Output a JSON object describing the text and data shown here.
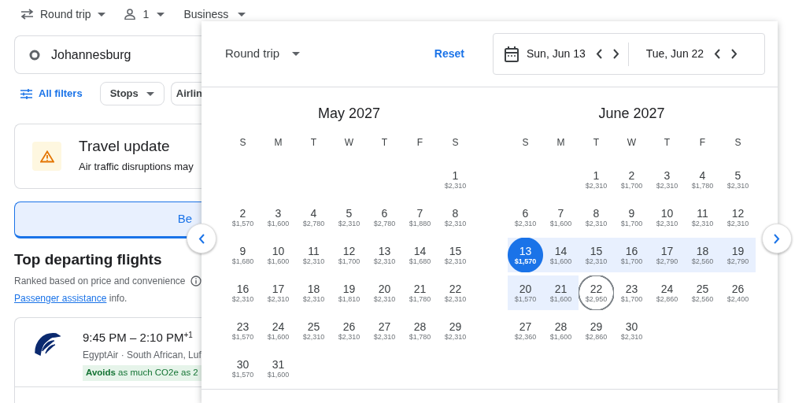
{
  "top_bar": {
    "trip_type": "Round trip",
    "passengers": "1",
    "cabin": "Business"
  },
  "origin": {
    "value": "Johannesburg"
  },
  "filters": [
    {
      "label": "All filters",
      "kind": "link"
    },
    {
      "label": "Stops",
      "kind": "dropdown"
    },
    {
      "label": "Airlin",
      "kind": "chip"
    }
  ],
  "alert": {
    "title": "Travel update",
    "text": "Air traffic disruptions may"
  },
  "tabs": [
    {
      "label": "Be",
      "selected": true
    }
  ],
  "section": {
    "title": "Top departing flights",
    "subtitle": "Ranked based on price and convenience",
    "link": "Passenger assistance",
    "after_link": "info."
  },
  "flights": [
    {
      "times": "9:45 PM – 2:10 PM",
      "day_offset": "+1",
      "airlines": "EgyptAir · South African, Luf",
      "emissions": "**Avoids** as much CO2e as 2"
    }
  ],
  "date_picker": {
    "trip_type": "Round trip",
    "reset": "Reset",
    "departure": "Sun, Jun 13",
    "return": "Tue, Jun 22",
    "months": [
      {
        "title": "May 2027",
        "weekdays": [
          "S",
          "M",
          "T",
          "W",
          "T",
          "F",
          "S"
        ],
        "weeks": [
          [
            {
              "day": "1",
              "price": "$2,310",
              "selected": false,
              "in_range": false
            }
          ],
          [
            {
              "day": "2",
              "price": "$1,570",
              "selected": false,
              "in_range": false
            },
            {
              "day": "3",
              "price": "$1,600",
              "selected": false,
              "in_range": false
            },
            {
              "day": "4",
              "price": "$2,780",
              "selected": false,
              "in_range": false
            },
            {
              "day": "5",
              "price": "$2,310",
              "selected": false,
              "in_range": false
            },
            {
              "day": "6",
              "price": "$2,780",
              "selected": false,
              "in_range": false
            },
            {
              "day": "7",
              "price": "$1,880",
              "selected": false,
              "in_range": false
            },
            {
              "day": "8",
              "price": "$2,310",
              "selected": false,
              "in_range": false
            }
          ],
          [
            {
              "day": "9",
              "price": "$1,680",
              "selected": false,
              "in_range": false
            },
            {
              "day": "10",
              "price": "$1,600",
              "selected": false,
              "in_range": false
            },
            {
              "day": "11",
              "price": "$2,310",
              "selected": false,
              "in_range": false
            },
            {
              "day": "12",
              "price": "$1,700",
              "selected": false,
              "in_range": false
            },
            {
              "day": "13",
              "price": "$2,310",
              "selected": false,
              "in_range": false
            },
            {
              "day": "14",
              "price": "$1,680",
              "selected": false,
              "in_range": false
            },
            {
              "day": "15",
              "price": "$2,310",
              "selected": false,
              "in_range": false
            }
          ],
          [
            {
              "day": "16",
              "price": "$2,310",
              "selected": false,
              "in_range": false
            },
            {
              "day": "17",
              "price": "$2,310",
              "selected": false,
              "in_range": false
            },
            {
              "day": "18",
              "price": "$2,310",
              "selected": false,
              "in_range": false
            },
            {
              "day": "19",
              "price": "$1,810",
              "selected": false,
              "in_range": false
            },
            {
              "day": "20",
              "price": "$2,310",
              "selected": false,
              "in_range": false
            },
            {
              "day": "21",
              "price": "$1,780",
              "selected": false,
              "in_range": false
            },
            {
              "day": "22",
              "price": "$2,310",
              "selected": false,
              "in_range": false
            }
          ],
          [
            {
              "day": "23",
              "price": "$1,570",
              "selected": false,
              "in_range": false
            },
            {
              "day": "24",
              "price": "$1,600",
              "selected": false,
              "in_range": false
            },
            {
              "day": "25",
              "price": "$2,310",
              "selected": false,
              "in_range": false
            },
            {
              "day": "26",
              "price": "$2,310",
              "selected": false,
              "in_range": false
            },
            {
              "day": "27",
              "price": "$2,310",
              "selected": false,
              "in_range": false
            },
            {
              "day": "28",
              "price": "$1,780",
              "selected": false,
              "in_range": false
            },
            {
              "day": "29",
              "price": "$2,310",
              "selected": false,
              "in_range": false
            }
          ],
          [
            {
              "day": "30",
              "price": "$1,570",
              "selected": false,
              "in_range": false
            },
            {
              "day": "31",
              "price": "$1,600",
              "selected": false,
              "in_range": false
            }
          ]
        ]
      },
      {
        "title": "June 2027",
        "weekdays": [
          "S",
          "M",
          "T",
          "W",
          "T",
          "F",
          "S"
        ],
        "weeks": [
          [
            {
              "day": "1",
              "price": "$2,310",
              "selected": false,
              "in_range": false
            },
            {
              "day": "2",
              "price": "$1,700",
              "selected": false,
              "in_range": false
            },
            {
              "day": "3",
              "price": "$2,310",
              "selected": false,
              "in_range": false
            },
            {
              "day": "4",
              "price": "$1,780",
              "selected": false,
              "in_range": false
            },
            {
              "day": "5",
              "price": "$2,310",
              "selected": false,
              "in_range": false
            }
          ],
          [
            {
              "day": "6",
              "price": "$2,310",
              "selected": false,
              "in_range": false
            },
            {
              "day": "7",
              "price": "$1,600",
              "selected": false,
              "in_range": false
            },
            {
              "day": "8",
              "price": "$2,310",
              "selected": false,
              "in_range": false
            },
            {
              "day": "9",
              "price": "$1,700",
              "selected": false,
              "in_range": false
            },
            {
              "day": "10",
              "price": "$2,310",
              "selected": false,
              "in_range": false
            },
            {
              "day": "11",
              "price": "$2,310",
              "selected": false,
              "in_range": false
            },
            {
              "day": "12",
              "price": "$2,310",
              "selected": false,
              "in_range": false
            }
          ],
          [
            {
              "day": "13",
              "price": "$1,570",
              "selected": true,
              "in_range": true
            },
            {
              "day": "14",
              "price": "$1,600",
              "selected": false,
              "in_range": true
            },
            {
              "day": "15",
              "price": "$2,310",
              "selected": false,
              "in_range": true
            },
            {
              "day": "16",
              "price": "$1,700",
              "selected": false,
              "in_range": true
            },
            {
              "day": "17",
              "price": "$2,790",
              "selected": false,
              "in_range": true
            },
            {
              "day": "18",
              "price": "$2,560",
              "selected": false,
              "in_range": true
            },
            {
              "day": "19",
              "price": "$2,790",
              "selected": false,
              "in_range": true
            }
          ],
          [
            {
              "day": "20",
              "price": "$1,570",
              "selected": false,
              "in_range": true
            },
            {
              "day": "21",
              "price": "$1,600",
              "selected": false,
              "in_range": true
            },
            {
              "day": "22",
              "price": "$2,950",
              "selected": true,
              "in_range": false
            },
            {
              "day": "23",
              "price": "$1,700",
              "selected": false,
              "in_range": false
            },
            {
              "day": "24",
              "price": "$2,860",
              "selected": false,
              "in_range": false
            },
            {
              "day": "25",
              "price": "$2,560",
              "selected": false,
              "in_range": false
            },
            {
              "day": "26",
              "price": "$2,400",
              "selected": false,
              "in_range": false
            }
          ],
          [
            {
              "day": "27",
              "price": "$2,360",
              "selected": false,
              "in_range": false
            },
            {
              "day": "28",
              "price": "$1,600",
              "selected": false,
              "in_range": false
            },
            {
              "day": "29",
              "price": "$2,860",
              "selected": false,
              "in_range": false
            },
            {
              "day": "30",
              "price": "$2,310",
              "selected": false,
              "in_range": false
            }
          ]
        ]
      }
    ]
  }
}
